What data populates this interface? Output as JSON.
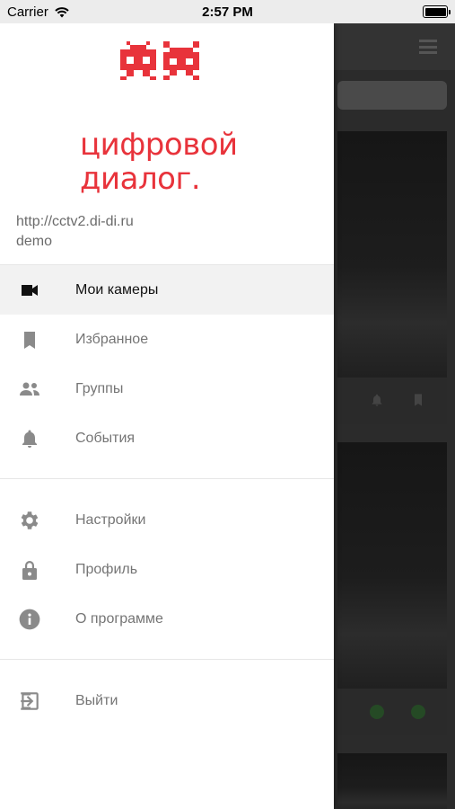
{
  "status_bar": {
    "carrier": "Carrier",
    "time": "2:57 PM"
  },
  "drawer": {
    "brand_line1": "цифровой",
    "brand_line2": "диалог.",
    "server_url": "http://cctv2.di-di.ru",
    "username": "demo",
    "accent_color": "#e8333b",
    "menu": [
      {
        "label": "Мои камеры",
        "icon": "video-camera-icon",
        "active": true
      },
      {
        "label": "Избранное",
        "icon": "bookmark-icon"
      },
      {
        "label": "Группы",
        "icon": "people-icon"
      },
      {
        "label": "События",
        "icon": "bell-icon"
      },
      {
        "label": "Настройки",
        "icon": "gear-icon"
      },
      {
        "label": "Профиль",
        "icon": "lock-icon"
      },
      {
        "label": "О программе",
        "icon": "info-icon"
      },
      {
        "label": "Выйти",
        "icon": "logout-icon"
      }
    ]
  }
}
